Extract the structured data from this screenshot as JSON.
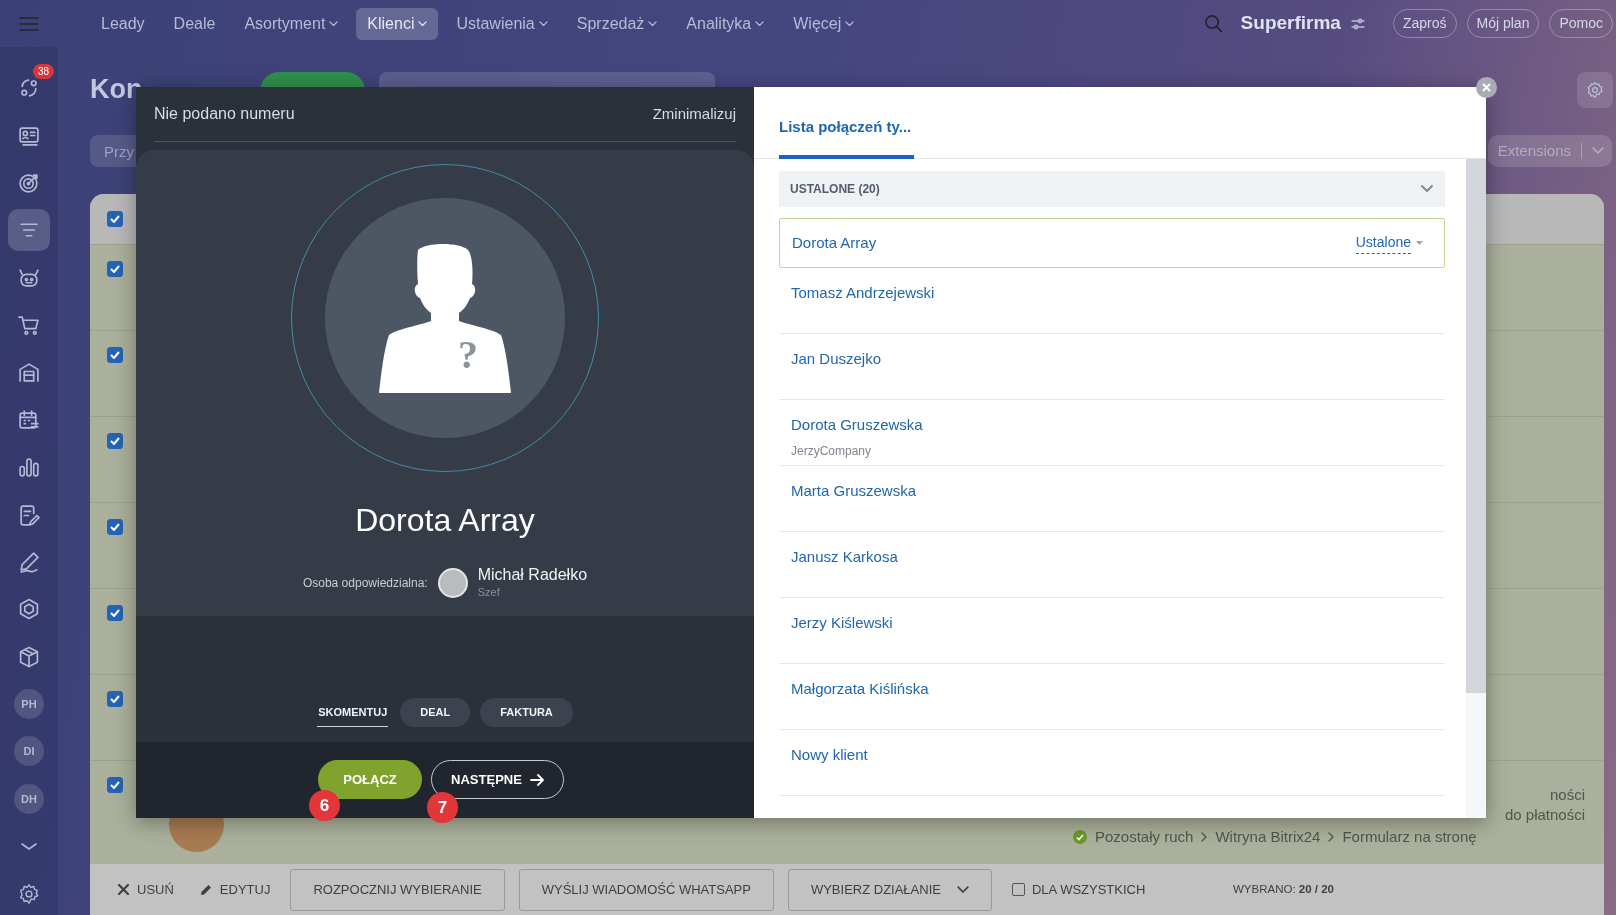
{
  "top_nav": {
    "items": [
      {
        "label": "Leady",
        "selected": false,
        "dropdown": false
      },
      {
        "label": "Deale",
        "selected": false,
        "dropdown": false
      },
      {
        "label": "Asortyment",
        "selected": false,
        "dropdown": true
      },
      {
        "label": "Klienci",
        "selected": true,
        "dropdown": true
      },
      {
        "label": "Ustawienia",
        "selected": false,
        "dropdown": true
      },
      {
        "label": "Sprzedaż",
        "selected": false,
        "dropdown": true
      },
      {
        "label": "Analityka",
        "selected": false,
        "dropdown": true
      },
      {
        "label": "Więcej",
        "selected": false,
        "dropdown": true
      }
    ],
    "company": "Superfirma",
    "buttons": [
      "Zaproś",
      "Mój plan",
      "Pomoc"
    ]
  },
  "sidebar": {
    "items": [
      {
        "kind": "icon",
        "selected": false,
        "badge": "38"
      },
      {
        "kind": "icon",
        "selected": false
      },
      {
        "kind": "icon",
        "selected": false
      },
      {
        "kind": "icon",
        "selected": true
      },
      {
        "kind": "icon",
        "selected": false
      },
      {
        "kind": "icon",
        "selected": false
      },
      {
        "kind": "icon",
        "selected": false
      },
      {
        "kind": "icon",
        "selected": false
      },
      {
        "kind": "icon",
        "selected": false
      },
      {
        "kind": "icon",
        "selected": false
      },
      {
        "kind": "icon",
        "selected": false
      },
      {
        "kind": "icon",
        "selected": false
      },
      {
        "kind": "icon",
        "selected": false
      },
      {
        "kind": "initials",
        "text": "PH",
        "selected": false
      },
      {
        "kind": "initials",
        "text": "DI",
        "selected": false
      },
      {
        "kind": "initials",
        "text": "DH",
        "selected": false
      },
      {
        "kind": "more",
        "selected": false
      },
      {
        "kind": "settings",
        "selected": false
      }
    ]
  },
  "page": {
    "title": "Kon",
    "filter_chip": "Przy",
    "extensions": "Extensions",
    "table": {
      "header_checked": true,
      "rows": [
        {
          "checked": true
        },
        {
          "checked": true
        },
        {
          "checked": true
        },
        {
          "checked": true
        },
        {
          "checked": true
        },
        {
          "checked": true
        },
        {
          "checked": true,
          "details": [
            "ności",
            "do płatności"
          ],
          "path": [
            "Pozostały ruch",
            "Witryna Bitrix24",
            "Formularz na stronę"
          ]
        }
      ]
    }
  },
  "bottom_bar": {
    "delete": "USUŃ",
    "edit": "EDYTUJ",
    "buttons": [
      "ROZPOCZNIJ WYBIERANIE",
      "WYŚLIJ WIADOMOŚĆ WHATSAPP"
    ],
    "action_select": "WYBIERZ DZIAŁANIE",
    "for_all": {
      "label": "DLA WSZYSTKICH",
      "checked": false
    },
    "selected_label": "WYBRANO:",
    "selected_count": "20 / 20"
  },
  "call_dialog": {
    "phone": "Nie podano numeru",
    "minimize": "Zminimalizuj",
    "unknown_mark": "?",
    "contact_name": "Dorota Array",
    "responsible_label": "Osoba odpowiedzialna:",
    "responsible": {
      "name": "Michał Radełko",
      "position": "Szef"
    },
    "actions": [
      {
        "label": "SKOMENTUJ",
        "selected": true
      },
      {
        "label": "DEAL",
        "selected": false
      },
      {
        "label": "FAKTURA",
        "selected": false
      }
    ],
    "call_button": {
      "label": "POŁĄCZ",
      "marker": "6"
    },
    "next_button": {
      "label": "NASTĘPNE",
      "marker": "7"
    }
  },
  "call_list": {
    "tabs": [
      {
        "label": "Lista połączeń ty...",
        "selected": true
      }
    ],
    "group": {
      "title": "USTALONE (20)",
      "expanded": true
    },
    "contacts": [
      {
        "name": "Dorota Array",
        "selected": true,
        "status": "Ustalone"
      },
      {
        "name": "Tomasz Andrzejewski",
        "selected": false
      },
      {
        "name": "Jan Duszejko",
        "selected": false
      },
      {
        "name": "Dorota Gruszewska",
        "company": "JerzyCompany",
        "selected": false
      },
      {
        "name": "Marta Gruszewska",
        "selected": false
      },
      {
        "name": "Janusz Karkosa",
        "selected": false
      },
      {
        "name": "Jerzy Kiślewski",
        "selected": false
      },
      {
        "name": "Małgorzata Kiślińska",
        "selected": false
      },
      {
        "name": "Nowy klient",
        "selected": false
      }
    ]
  }
}
